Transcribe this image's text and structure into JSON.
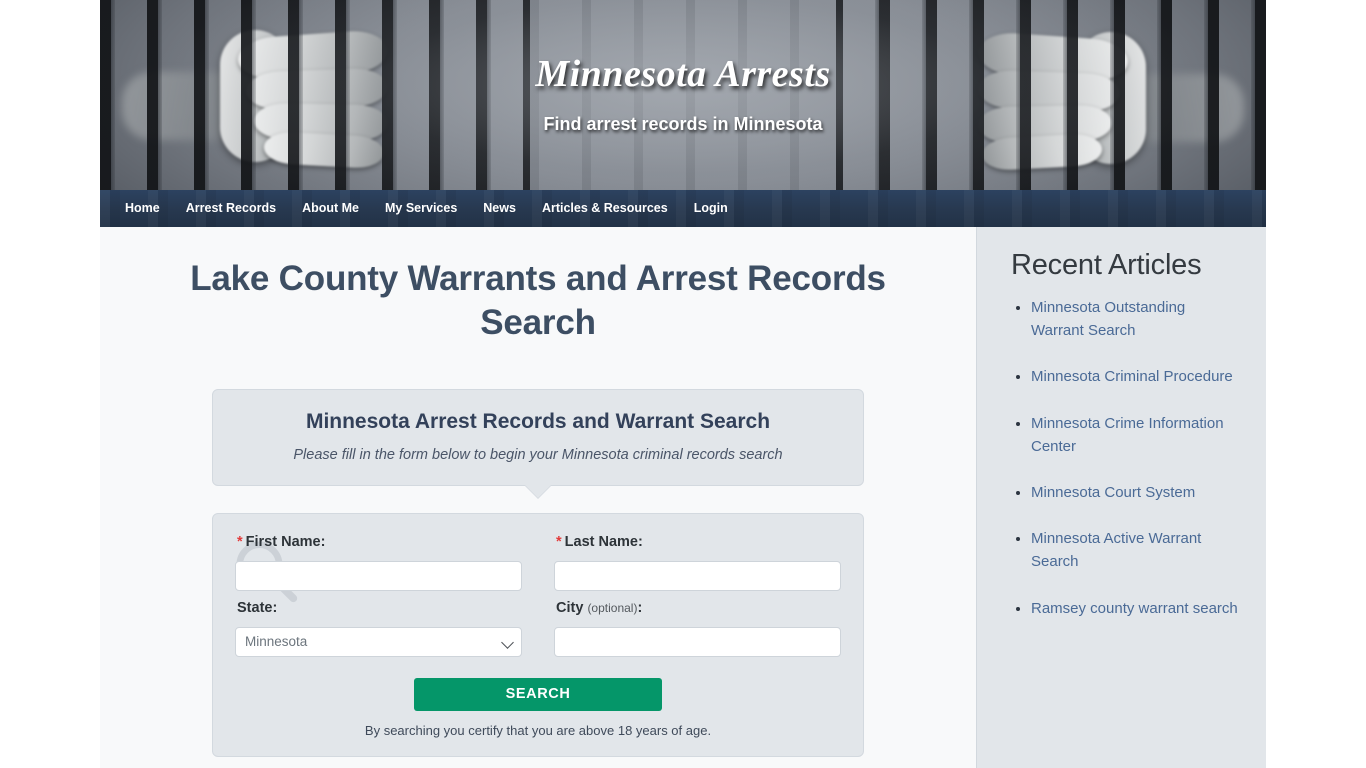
{
  "site": {
    "title": "Minnesota Arrests",
    "tagline": "Find arrest records in Minnesota"
  },
  "nav": {
    "items": [
      {
        "label": "Home"
      },
      {
        "label": "Arrest Records"
      },
      {
        "label": "About Me"
      },
      {
        "label": "My Services"
      },
      {
        "label": "News"
      },
      {
        "label": "Articles & Resources"
      },
      {
        "label": "Login"
      }
    ]
  },
  "main": {
    "page_title": "Lake County Warrants and Arrest Records Search",
    "callout": {
      "heading": "Minnesota Arrest Records and Warrant Search",
      "subtext": "Please fill in the form below to begin your Minnesota criminal records search"
    },
    "form": {
      "first_name": {
        "label": "First Name:",
        "required_marker": "*",
        "value": "",
        "placeholder": ""
      },
      "last_name": {
        "label": "Last Name:",
        "required_marker": "*",
        "value": "",
        "placeholder": ""
      },
      "state": {
        "label": "State:",
        "selected": "Minnesota"
      },
      "city": {
        "label": "City",
        "optional_note": "(optional)",
        "label_suffix": ":",
        "value": "",
        "placeholder": ""
      },
      "submit_label": "SEARCH",
      "disclaimer": "By searching you certify that you are above 18 years of age."
    }
  },
  "sidebar": {
    "heading": "Recent Articles",
    "articles": [
      {
        "label": "Minnesota Outstanding Warrant Search"
      },
      {
        "label": "Minnesota Criminal Procedure"
      },
      {
        "label": "Minnesota Crime Information Center"
      },
      {
        "label": "Minnesota Court System"
      },
      {
        "label": "Minnesota Active Warrant Search"
      },
      {
        "label": "Ramsey county warrant search"
      }
    ]
  },
  "colors": {
    "nav_background": "#27384f",
    "title_text": "#3d4e63",
    "panel_background": "#e2e6ea",
    "sidebar_background": "#e2e6ea",
    "link": "#4a6a96",
    "submit_green": "#059669",
    "required_red": "#e23b3b"
  }
}
